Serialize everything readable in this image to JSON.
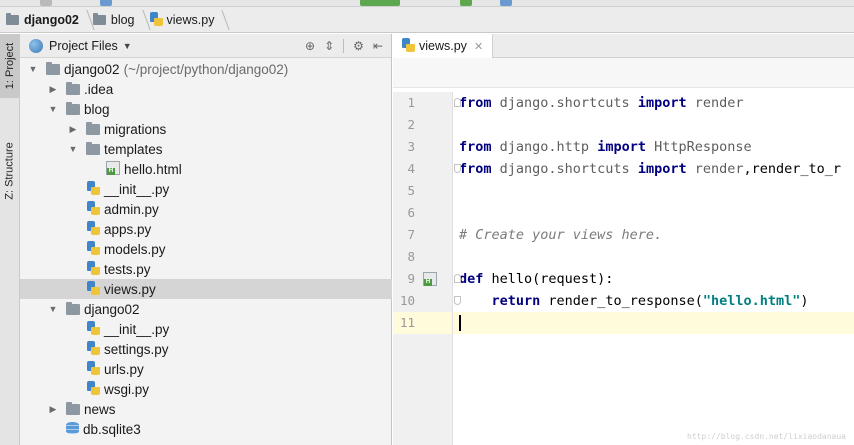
{
  "breadcrumb": [
    {
      "label": "django02",
      "bold": true,
      "icon": "folder-icon"
    },
    {
      "label": "blog",
      "bold": false,
      "icon": "folder-icon"
    },
    {
      "label": "views.py",
      "bold": false,
      "icon": "python-file-icon"
    }
  ],
  "side_tabs": {
    "project": "1: Project",
    "structure": "Z: Structure"
  },
  "project_panel": {
    "title": "Project Files",
    "tree": [
      {
        "label": "django02",
        "hint": "(~/project/python/django02)",
        "type": "folder",
        "depth": 0,
        "arrow": "open"
      },
      {
        "label": ".idea",
        "type": "folder",
        "depth": 1,
        "arrow": "closed"
      },
      {
        "label": "blog",
        "type": "folder",
        "depth": 1,
        "arrow": "open"
      },
      {
        "label": "migrations",
        "type": "folder",
        "depth": 2,
        "arrow": "closed"
      },
      {
        "label": "templates",
        "type": "folder",
        "depth": 2,
        "arrow": "open"
      },
      {
        "label": "hello.html",
        "type": "html",
        "depth": 3,
        "arrow": ""
      },
      {
        "label": "__init__.py",
        "type": "py",
        "depth": 2,
        "arrow": ""
      },
      {
        "label": "admin.py",
        "type": "py",
        "depth": 2,
        "arrow": ""
      },
      {
        "label": "apps.py",
        "type": "py",
        "depth": 2,
        "arrow": ""
      },
      {
        "label": "models.py",
        "type": "py",
        "depth": 2,
        "arrow": ""
      },
      {
        "label": "tests.py",
        "type": "py",
        "depth": 2,
        "arrow": ""
      },
      {
        "label": "views.py",
        "type": "py",
        "depth": 2,
        "arrow": "",
        "selected": true
      },
      {
        "label": "django02",
        "type": "folder",
        "depth": 1,
        "arrow": "open"
      },
      {
        "label": "__init__.py",
        "type": "py",
        "depth": 2,
        "arrow": ""
      },
      {
        "label": "settings.py",
        "type": "py",
        "depth": 2,
        "arrow": ""
      },
      {
        "label": "urls.py",
        "type": "py",
        "depth": 2,
        "arrow": ""
      },
      {
        "label": "wsgi.py",
        "type": "py",
        "depth": 2,
        "arrow": ""
      },
      {
        "label": "news",
        "type": "folder",
        "depth": 1,
        "arrow": "closed"
      },
      {
        "label": "db.sqlite3",
        "type": "db",
        "depth": 1,
        "arrow": ""
      }
    ]
  },
  "editor": {
    "tab_label": "views.py",
    "lines": [
      {
        "num": "1",
        "tokens": [
          {
            "t": "from",
            "c": "kw"
          },
          {
            "t": " django.shortcuts ",
            "c": "id"
          },
          {
            "t": "import",
            "c": "kw"
          },
          {
            "t": " render",
            "c": "id"
          }
        ]
      },
      {
        "num": "2",
        "tokens": []
      },
      {
        "num": "3",
        "tokens": [
          {
            "t": "from",
            "c": "kw"
          },
          {
            "t": " django.http ",
            "c": "id"
          },
          {
            "t": "import",
            "c": "kw"
          },
          {
            "t": " HttpResponse",
            "c": "id"
          }
        ]
      },
      {
        "num": "4",
        "tokens": [
          {
            "t": "from",
            "c": "kw"
          },
          {
            "t": " django.shortcuts ",
            "c": "id"
          },
          {
            "t": "import",
            "c": "kw"
          },
          {
            "t": " render",
            "c": "id"
          },
          {
            "t": ",render_to_r",
            "c": "plain"
          }
        ]
      },
      {
        "num": "5",
        "tokens": []
      },
      {
        "num": "6",
        "tokens": []
      },
      {
        "num": "7",
        "tokens": [
          {
            "t": "# Create your views here.",
            "c": "cmt"
          }
        ]
      },
      {
        "num": "8",
        "tokens": []
      },
      {
        "num": "9",
        "tokens": [
          {
            "t": "def",
            "c": "kw"
          },
          {
            "t": " hello(request):",
            "c": "plain"
          }
        ]
      },
      {
        "num": "10",
        "tokens": [
          {
            "t": "    ",
            "c": "plain"
          },
          {
            "t": "return",
            "c": "kw"
          },
          {
            "t": " render_to_response(",
            "c": "plain"
          },
          {
            "t": "\"hello.html\"",
            "c": "str"
          },
          {
            "t": ")",
            "c": "plain"
          }
        ]
      },
      {
        "num": "11",
        "tokens": [],
        "current": true
      }
    ]
  },
  "watermark": "http://blog.csdn.net/lixiaodanaua",
  "colors": {
    "keyword": "#000080",
    "string": "#008080",
    "comment": "#7b7b7b",
    "current_line": "#fffbdb",
    "selection": "#d5d5d5"
  }
}
